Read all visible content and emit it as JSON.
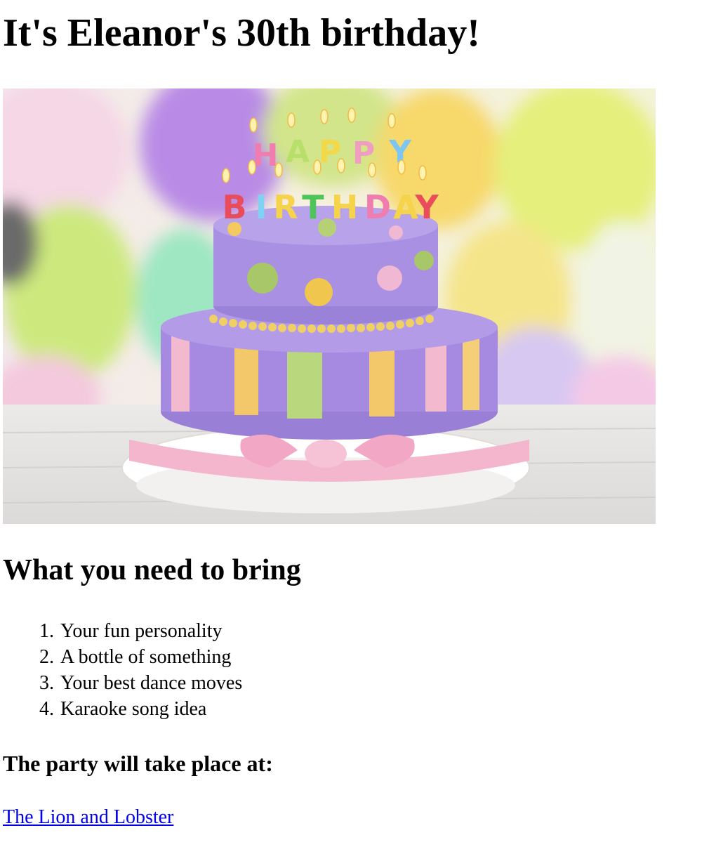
{
  "page": {
    "title": "It's Eleanor's 30th birthday!"
  },
  "hero": {
    "cake_candle_letters_top": [
      "H",
      "A",
      "P",
      "P",
      "Y"
    ],
    "cake_candle_letters_bottom": [
      "B",
      "I",
      "R",
      "T",
      "H",
      "D",
      "A",
      "Y"
    ]
  },
  "bring": {
    "heading": "What you need to bring",
    "items": [
      "Your fun personality",
      "A bottle of something",
      "Your best dance moves",
      "Karaoke song idea"
    ]
  },
  "place": {
    "heading": "The party will take place at:",
    "link_text": "The Lion and Lobster"
  },
  "colors": {
    "link": "#0000ee",
    "text": "#000000",
    "background": "#ffffff"
  }
}
